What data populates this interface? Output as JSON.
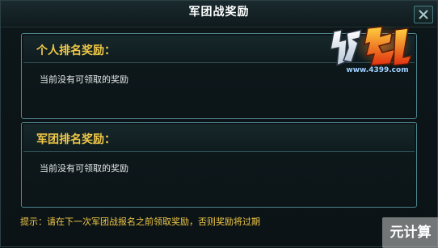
{
  "window": {
    "title": "军团战奖励"
  },
  "logo": {
    "name": "枪魂",
    "site": "www.4399.com"
  },
  "panels": [
    {
      "title": "个人排名奖励：",
      "body": "当前没有可领取的奖励"
    },
    {
      "title": "军团排名奖励：",
      "body": "当前没有可领取的奖励"
    }
  ],
  "tip": "提示：请在下一次军团战报名之前领取奖励，否则奖励将过期",
  "watermark": "元计算",
  "colors": {
    "title_gold": "#f0c848",
    "panel_border": "#4f8790",
    "background": "#0b1316"
  },
  "icons": {
    "close": "close-icon"
  }
}
